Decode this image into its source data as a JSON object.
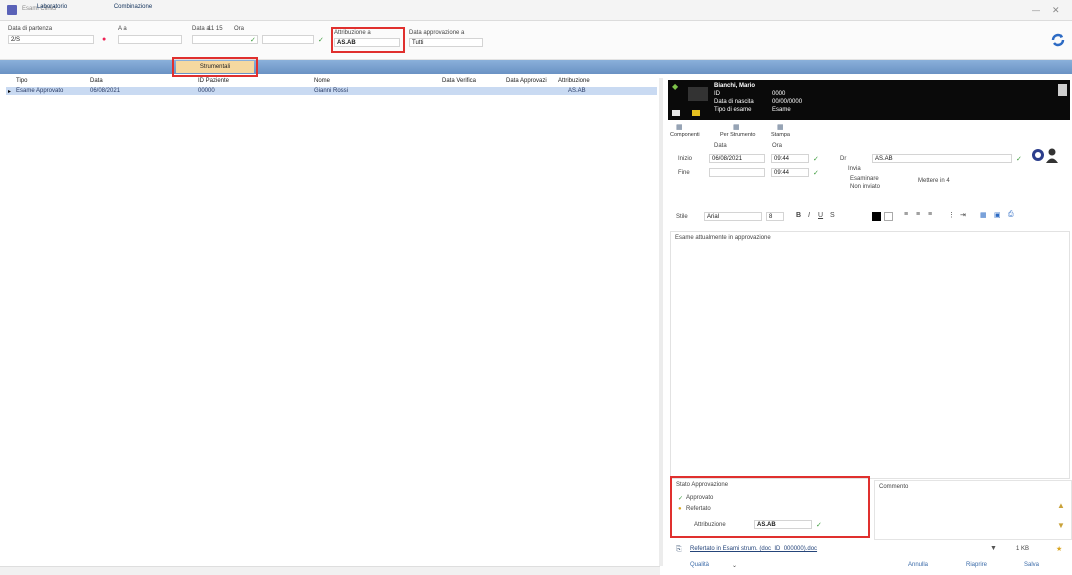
{
  "window": {
    "title": "Esami Clinici"
  },
  "filters": {
    "from_label": "Data di partenza",
    "from_value": "2/S",
    "to_label": "A a",
    "date_label": "Data a",
    "hour_value": "11 15",
    "al_label": "Ora",
    "attribution_label": "Attribuzione a",
    "attribution_value": "AS.AB",
    "approval_label": "Data approvazione a",
    "approval_value": "Tutti"
  },
  "tabs": [
    {
      "label": "Laboratorio"
    },
    {
      "label": "Combinazione"
    },
    {
      "label": "Strumentali"
    }
  ],
  "grid": {
    "headers": [
      "Tipo",
      "Data",
      "ID Paziente",
      "Nome",
      "Data Verifica",
      "Data Approvazi",
      "Attribuzione"
    ],
    "rows": [
      [
        "Esame Approvato",
        "06/08/2021",
        "00000",
        "Gianni Rossi",
        "",
        "",
        "AS.AB"
      ]
    ]
  },
  "patient": {
    "name": "Bianchi, Mario",
    "line2_label": "ID",
    "line2_value": "0000",
    "line3_label": "Data di nascita",
    "line3_value": "00/00/0000",
    "line4_label": "Tipo di esame",
    "line4_value": "Esame"
  },
  "toolbar": {
    "btn1": "Componenti",
    "btn2": "Per Strumento",
    "btn3": "Stampa"
  },
  "form": {
    "date_col": "Data",
    "time_col": "Ora",
    "row1_label": "Inizio",
    "row1_date": "06/08/2021",
    "row1_time": "09:44",
    "row1_field": "Dr",
    "row1_value": "AS.AB",
    "row2_label": "Fine",
    "row2_time": "09:44",
    "check_label": "Invia",
    "opt1": "Esaminare",
    "opt2": "Non inviato",
    "opt3": "Mettere in 4"
  },
  "editor": {
    "font": "Arial",
    "size": "8",
    "content": "Esame attualmente in approvazione"
  },
  "approval": {
    "title": "Stato Approvazione",
    "opt1": "Approvato",
    "opt2": "Refertato",
    "attr_label": "Attribuzione",
    "attr_value": "AS.AB"
  },
  "comment": {
    "label": "Commento"
  },
  "document": {
    "name": "Refertato in Esami strum. (doc_ID_000000).doc",
    "size": "1 KB"
  },
  "footer": {
    "dropdown": "Qualità",
    "cancel": "Annulla",
    "reopen": "Riaprire",
    "save": "Salva"
  }
}
